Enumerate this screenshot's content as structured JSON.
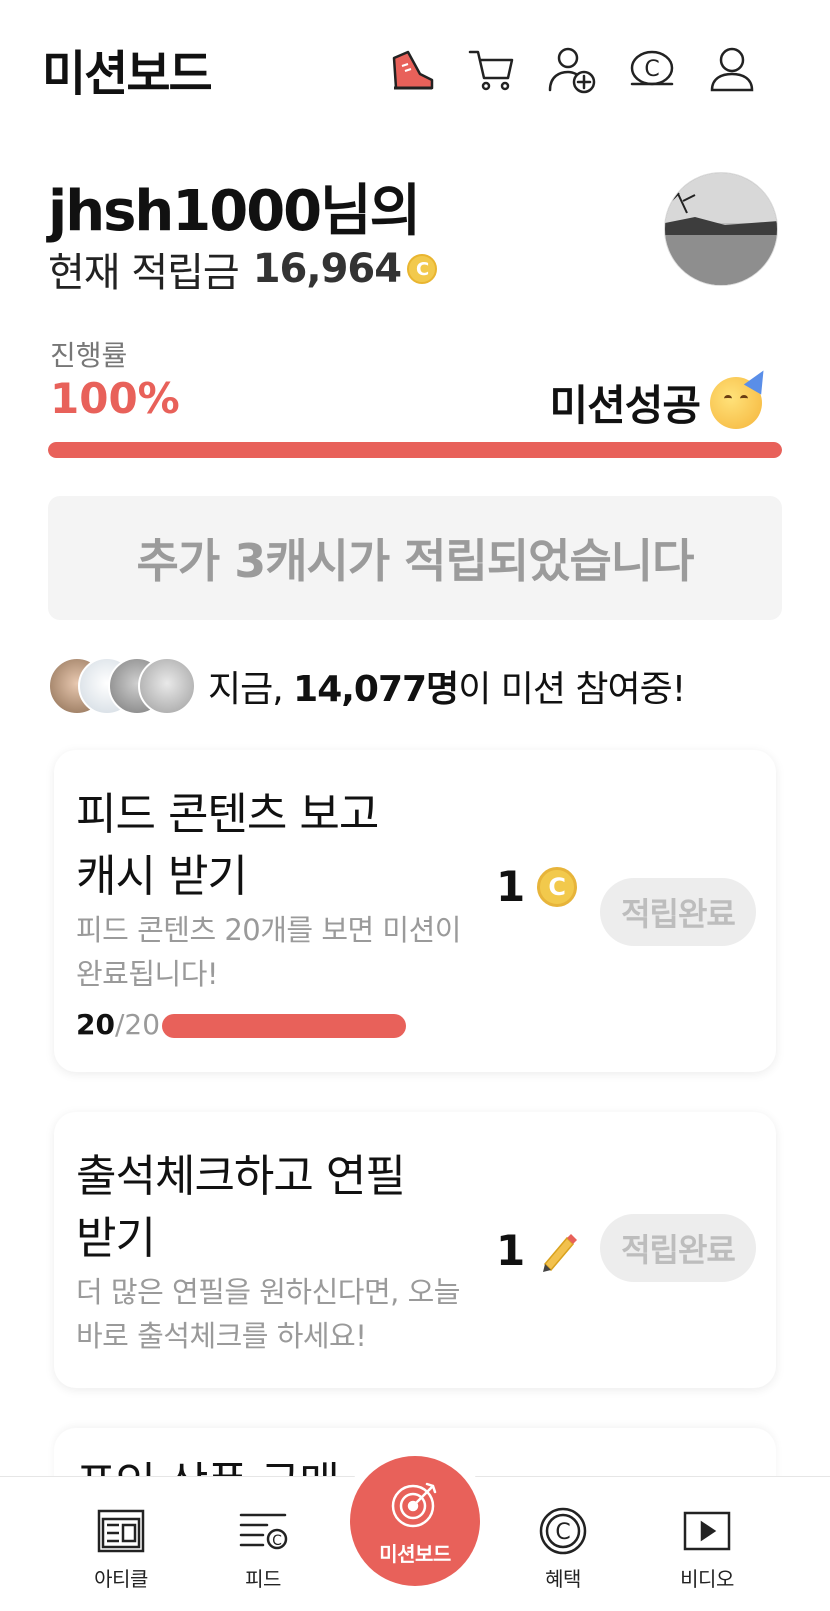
{
  "header": {
    "title": "미션보드",
    "icons": [
      "shoe-icon",
      "cart-icon",
      "add-friend-icon",
      "cash-icon",
      "profile-icon"
    ]
  },
  "profile": {
    "greeting": "jhsh1000님의",
    "balance_label": "현재 적립금",
    "balance_value": "16,964",
    "currency_symbol": "C"
  },
  "progress": {
    "label": "진행률",
    "value": "100%",
    "fraction": 1.0,
    "status": "미션성공",
    "accent_color": "#e8615a"
  },
  "notice": {
    "text": "추가 3캐시가 적립되었습니다"
  },
  "participants": {
    "prefix": "지금, ",
    "count": "14,077명",
    "suffix": "이 미션 참여중!"
  },
  "missions": [
    {
      "title_line1": "피드 콘텐츠 보고",
      "title_line2": "캐시 받기",
      "desc_line1": "피드 콘텐츠 20개를 보면 미션이",
      "desc_line2": "완료됩니다!",
      "reward": "1",
      "reward_icon": "cash-coin-icon",
      "button": "적립완료",
      "progress_done": "20",
      "progress_total": "/20",
      "progress_fraction": 1.0
    },
    {
      "title_line1": "출석체크하고 연필",
      "title_line2": "받기",
      "desc_line1": "더 많은 연필을 원하신다면, 오늘",
      "desc_line2": "바로 출석체크를 하세요!",
      "reward": "1",
      "reward_icon": "pencil-icon",
      "button": "적립완료"
    }
  ],
  "peek_card": {
    "title": "포인 상품 구매"
  },
  "bottom_nav": {
    "items": [
      {
        "label": "아티클",
        "icon": "article-icon"
      },
      {
        "label": "피드",
        "icon": "feed-icon"
      },
      {
        "label": "미션보드",
        "icon": "target-icon"
      },
      {
        "label": "혜택",
        "icon": "benefit-icon"
      },
      {
        "label": "비디오",
        "icon": "video-icon"
      }
    ]
  }
}
